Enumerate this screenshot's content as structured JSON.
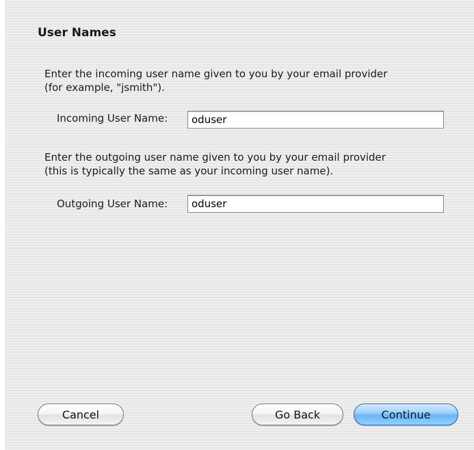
{
  "dialog": {
    "title": "User Names",
    "incoming": {
      "instruction_line1": "Enter the incoming user name given to you by your email provider",
      "instruction_line2": "(for example, \"jsmith\").",
      "label": "Incoming User Name:",
      "value": "oduser"
    },
    "outgoing": {
      "instruction_line1": "Enter the outgoing user name given to you by your email provider",
      "instruction_line2": "(this is typically the same as your incoming user name).",
      "label": "Outgoing User Name:",
      "value": "oduser"
    },
    "buttons": {
      "cancel": "Cancel",
      "go_back": "Go Back",
      "continue": "Continue"
    }
  },
  "colors": {
    "panel_background": "#ededed",
    "default_button_accent": "#6cb6f4"
  }
}
